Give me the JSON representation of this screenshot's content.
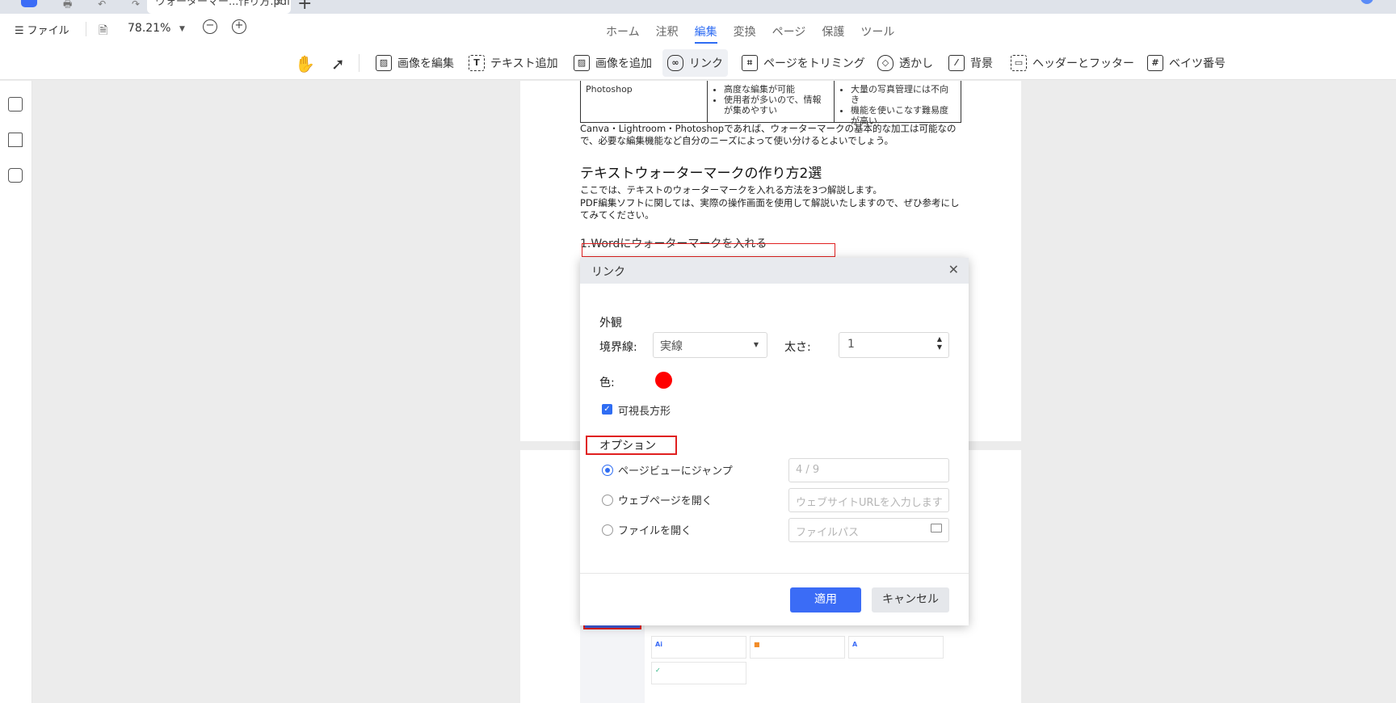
{
  "tabbar": {
    "doc_tab_title": "ウォーターマー...作り方.pdf",
    "close": "×",
    "new_tab": "+"
  },
  "toolbar": {
    "file_menu": "ファイル",
    "zoom": "78.21%",
    "zoom_out": "−",
    "zoom_in": "+",
    "nav_tabs": [
      "ホーム",
      "注釈",
      "編集",
      "変換",
      "ページ",
      "保護",
      "ツール"
    ],
    "active_tab": "編集",
    "tools": [
      "画像を編集",
      "テキスト追加",
      "画像を追加",
      "リンク",
      "ページをトリミング",
      "透かし",
      "背景",
      "ヘッダーとフッター",
      "ベイツ番号"
    ]
  },
  "document": {
    "table_col1": "Photoshop",
    "table_col2": [
      "高度な編集が可能",
      "使用者が多いので、情報が集めやすい"
    ],
    "table_col3": [
      "大量の写真管理には不向き",
      "機能を使いこなす難易度が高い"
    ],
    "para1": "Canva・Lightroom・Photoshopであれば、ウォーターマークの基本的な加工は可能なので、必要な編集機能など自分のニーズによって使い分けるとよいでしょう。",
    "heading": "テキストウォーターマークの作り方2選",
    "para2": "ここでは、テキストのウォーターマークを入れる方法を3つ解説します。",
    "para3": "PDF編集ソフトに関しては、実際の操作画面を使用して解説いたしますので、ぜひ参考にしてみてください。",
    "subheading": "1.Wordにウォーターマークを入れる"
  },
  "dialog": {
    "title": "リンク",
    "appearance": "外観",
    "border_label": "境界線:",
    "border_value": "実線",
    "thickness_label": "太さ:",
    "thickness_value": "1",
    "color_label": "色:",
    "color_value": "#ff0000",
    "visible_rect": "可視長方形",
    "options": "オプション",
    "opt_page": "ページビューにジャンプ",
    "opt_page_value": "4 / 9",
    "opt_web": "ウェブページを開く",
    "opt_web_placeholder": "ウェブサイトURLを入力します",
    "opt_file": "ファイルを開く",
    "opt_file_placeholder": "ファイルパス",
    "apply": "適用",
    "cancel": "キャンセル"
  }
}
